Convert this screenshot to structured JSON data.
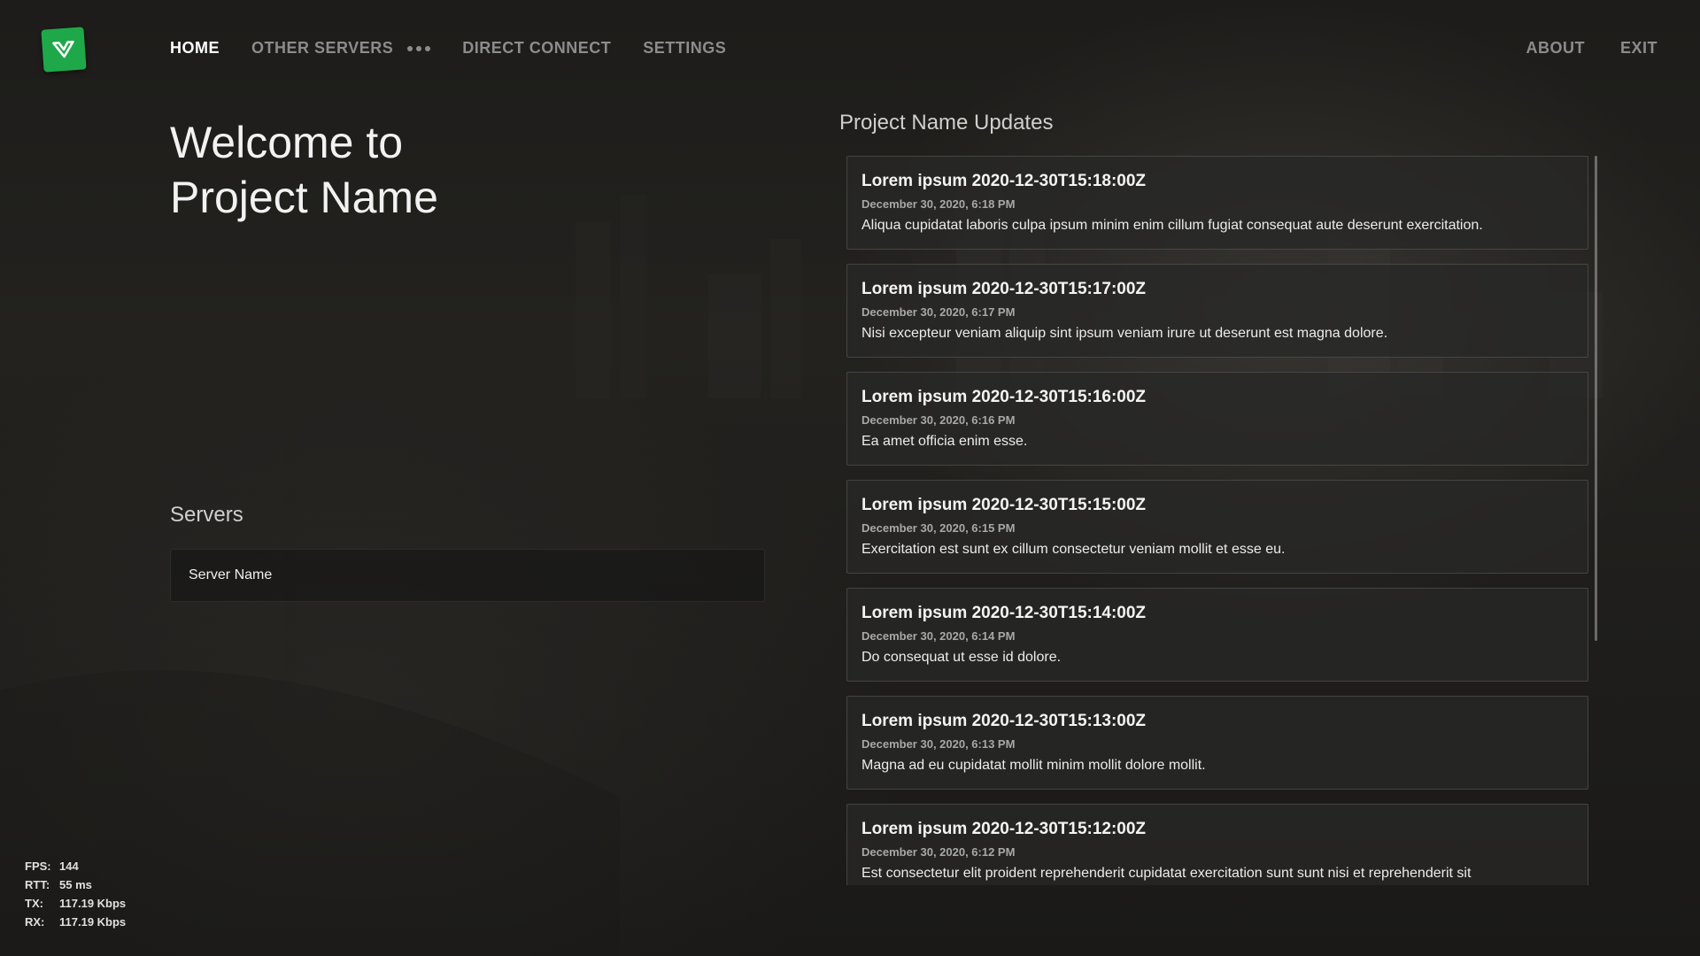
{
  "nav": {
    "left": [
      {
        "label": "HOME",
        "active": true
      },
      {
        "label": "OTHER SERVERS",
        "active": false
      },
      {
        "label": "DIRECT CONNECT",
        "active": false
      },
      {
        "label": "SETTINGS",
        "active": false
      }
    ],
    "right": [
      {
        "label": "ABOUT"
      },
      {
        "label": "EXIT"
      }
    ],
    "more_icon": "ellipsis-icon",
    "logo_icon": "v-logo-icon",
    "logo_color": "#1fa84a"
  },
  "welcome": {
    "line1": "Welcome to",
    "line2": "Project Name"
  },
  "servers": {
    "title": "Servers",
    "items": [
      {
        "name": "Server Name"
      }
    ]
  },
  "updates": {
    "title": "Project Name Updates",
    "items": [
      {
        "title": "Lorem ipsum 2020-12-30T15:18:00Z",
        "date": "December 30, 2020, 6:18 PM",
        "body": "Aliqua cupidatat laboris culpa ipsum minim enim cillum fugiat consequat aute deserunt exercitation."
      },
      {
        "title": "Lorem ipsum 2020-12-30T15:17:00Z",
        "date": "December 30, 2020, 6:17 PM",
        "body": "Nisi excepteur veniam aliquip sint ipsum veniam irure ut deserunt est magna dolore."
      },
      {
        "title": "Lorem ipsum 2020-12-30T15:16:00Z",
        "date": "December 30, 2020, 6:16 PM",
        "body": "Ea amet officia enim esse."
      },
      {
        "title": "Lorem ipsum 2020-12-30T15:15:00Z",
        "date": "December 30, 2020, 6:15 PM",
        "body": "Exercitation est sunt ex cillum consectetur veniam mollit et esse eu."
      },
      {
        "title": "Lorem ipsum 2020-12-30T15:14:00Z",
        "date": "December 30, 2020, 6:14 PM",
        "body": "Do consequat ut esse id dolore."
      },
      {
        "title": "Lorem ipsum 2020-12-30T15:13:00Z",
        "date": "December 30, 2020, 6:13 PM",
        "body": "Magna ad eu cupidatat mollit minim mollit dolore mollit."
      },
      {
        "title": "Lorem ipsum 2020-12-30T15:12:00Z",
        "date": "December 30, 2020, 6:12 PM",
        "body": "Est consectetur elit proident reprehenderit cupidatat exercitation sunt sunt nisi et reprehenderit sit"
      }
    ]
  },
  "stats": {
    "fps_label": "FPS:",
    "fps": "144",
    "rtt_label": "RTT:",
    "rtt": "55 ms",
    "tx_label": "TX:",
    "tx": "117.19 Kbps",
    "rx_label": "RX:",
    "rx": "117.19 Kbps"
  }
}
